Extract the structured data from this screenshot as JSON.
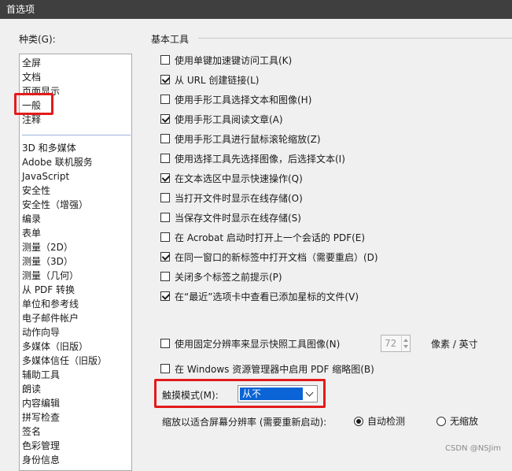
{
  "window": {
    "title": "首选项"
  },
  "categories": {
    "label": "种类(G):",
    "top_items": [
      "全屏",
      "文档",
      "页面显示",
      "一般",
      "注释"
    ],
    "selected": "一般",
    "items": [
      "3D 和多媒体",
      "Adobe 联机服务",
      "JavaScript",
      "安全性",
      "安全性（增强）",
      "编录",
      "表单",
      "测量（2D）",
      "测量（3D）",
      "测量（几何）",
      "从 PDF 转换",
      "单位和参考线",
      "电子邮件帐户",
      "动作向导",
      "多媒体（旧版）",
      "多媒体信任（旧版）",
      "辅助工具",
      "朗读",
      "内容编辑",
      "拼写检查",
      "签名",
      "色彩管理",
      "身份信息"
    ]
  },
  "basic_tools": {
    "title": "基本工具",
    "options": [
      {
        "label": "使用单键加速键访问工具(K)",
        "checked": false
      },
      {
        "label": "从 URL 创建链接(L)",
        "checked": true
      },
      {
        "label": "使用手形工具选择文本和图像(H)",
        "checked": false
      },
      {
        "label": "使用手形工具阅读文章(A)",
        "checked": true
      },
      {
        "label": "使用手形工具进行鼠标滚轮缩放(Z)",
        "checked": false
      },
      {
        "label": "使用选择工具先选择图像，后选择文本(I)",
        "checked": false
      },
      {
        "label": "在文本选区中显示快速操作(Q)",
        "checked": true
      },
      {
        "label": "当打开文件时显示在线存储(O)",
        "checked": false
      },
      {
        "label": "当保存文件时显示在线存储(S)",
        "checked": false
      },
      {
        "label": "在 Acrobat 启动时打开上一个会话的 PDF(E)",
        "checked": false
      },
      {
        "label": "在同一窗口的新标签中打开文档（需要重启）(D)",
        "checked": true
      },
      {
        "label": "关闭多个标签之前提示(P)",
        "checked": false
      },
      {
        "label": "在“最近”选项卡中查看已添加星标的文件(V)",
        "checked": true
      }
    ]
  },
  "snapshot": {
    "label": "使用固定分辨率来显示快照工具图像(N)",
    "checked": false,
    "value": "72",
    "unit": "像素 / 英寸"
  },
  "thumbnail": {
    "label": "在 Windows 资源管理器中启用 PDF 缩略图(B)",
    "checked": false
  },
  "touch_mode": {
    "label": "触摸模式(M):",
    "value": "从不"
  },
  "scaling": {
    "label": "缩放以适合屏幕分辨率 (需要重新启动):",
    "options": [
      {
        "label": "自动检测",
        "selected": true
      },
      {
        "label": "无缩放",
        "selected": false
      }
    ]
  },
  "watermark": "CSDN @NSJim",
  "colors": {
    "highlight": "#e31b1b",
    "selection": "#0a64d6",
    "titlebar": "#3f3f3f"
  }
}
